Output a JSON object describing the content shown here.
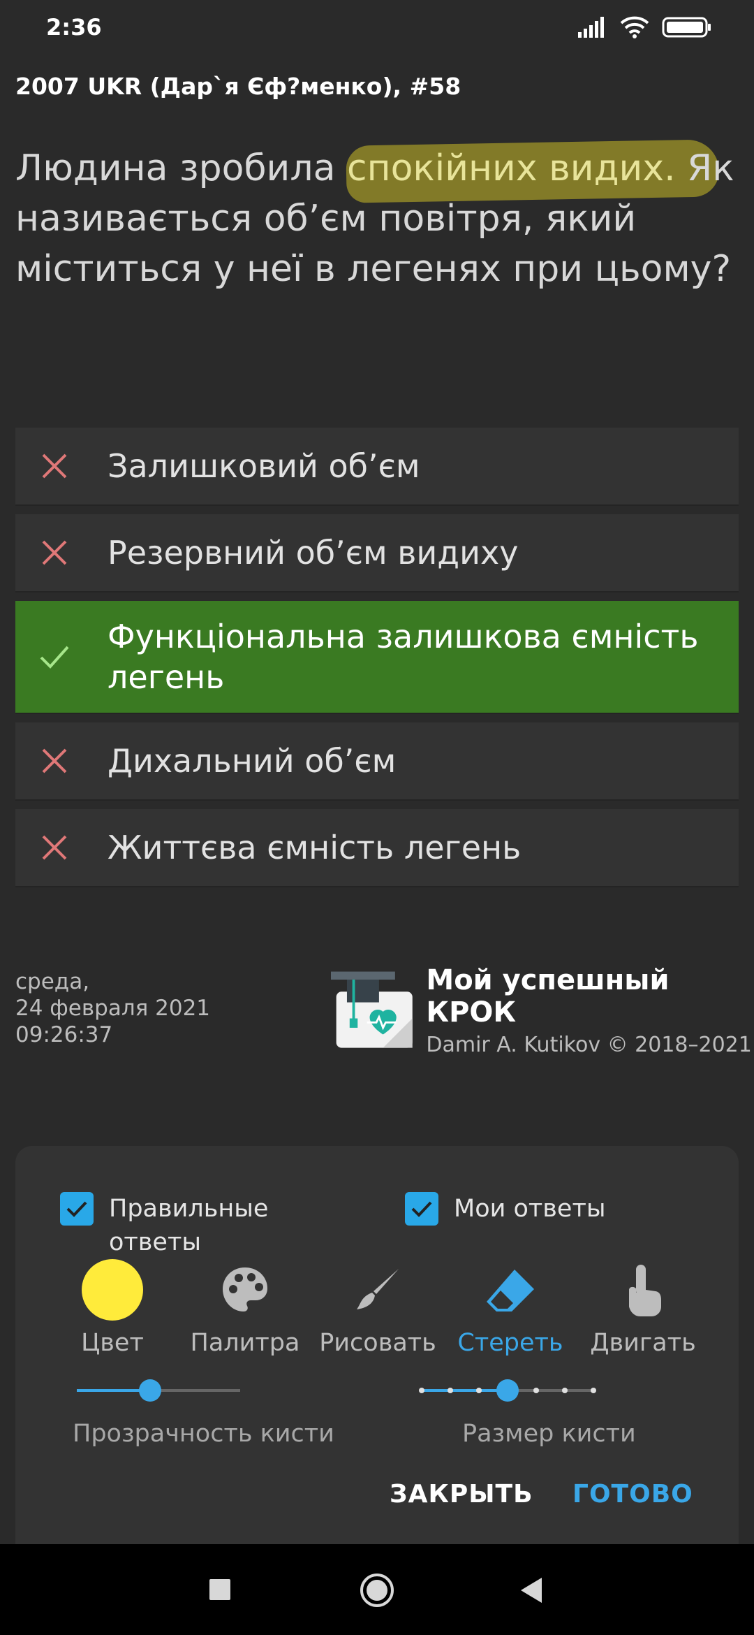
{
  "status_bar": {
    "time": "2:36",
    "icons": [
      "signal-icon",
      "wifi-icon",
      "battery-icon"
    ]
  },
  "header": {
    "title": "2007 UKR (Дар`я Єф?менко), #58"
  },
  "question": {
    "part1": "Людина зробила ",
    "highlighted": "спокійних видих.",
    "part2": "Як називається об’єм повітря, який міститься у неї в легенях при цьому?"
  },
  "answers": [
    {
      "text": "Залишковий об’єм",
      "status": "wrong"
    },
    {
      "text": "Резервний об’єм видиху",
      "status": "wrong"
    },
    {
      "text": "Функціональна залишкова ємність легень",
      "status": "correct"
    },
    {
      "text": "Дихальний об’єм",
      "status": "wrong"
    },
    {
      "text": "Життєва ємність легень",
      "status": "wrong"
    }
  ],
  "footer": {
    "date_line1": "среда,",
    "date_line2": "24 февраля 2021",
    "date_line3": "09:26:37",
    "app_name": "Мой успешный КРОК",
    "copyright": "Damir A. Kutikov © 2018–2021"
  },
  "panel": {
    "checkbox_correct_label": "Правильные ответы",
    "checkbox_mine_label": "Мои ответы",
    "tools": [
      {
        "label": "Цвет",
        "icon": "color-swatch-icon"
      },
      {
        "label": "Палитра",
        "icon": "palette-icon"
      },
      {
        "label": "Рисовать",
        "icon": "brush-icon"
      },
      {
        "label": "Стереть",
        "icon": "eraser-icon",
        "active": true
      },
      {
        "label": "Двигать",
        "icon": "hand-pointer-icon"
      }
    ],
    "opacity_label": "Прозрачность кисти",
    "opacity_value": 0.45,
    "size_label": "Размер кисти",
    "size_step": 4,
    "size_steps_total": 7,
    "close_label": "ЗАКРЫТЬ",
    "done_label": "ГОТОВО",
    "colors": {
      "accent": "#3aa7e8",
      "brush": "#ffeb3b"
    }
  }
}
